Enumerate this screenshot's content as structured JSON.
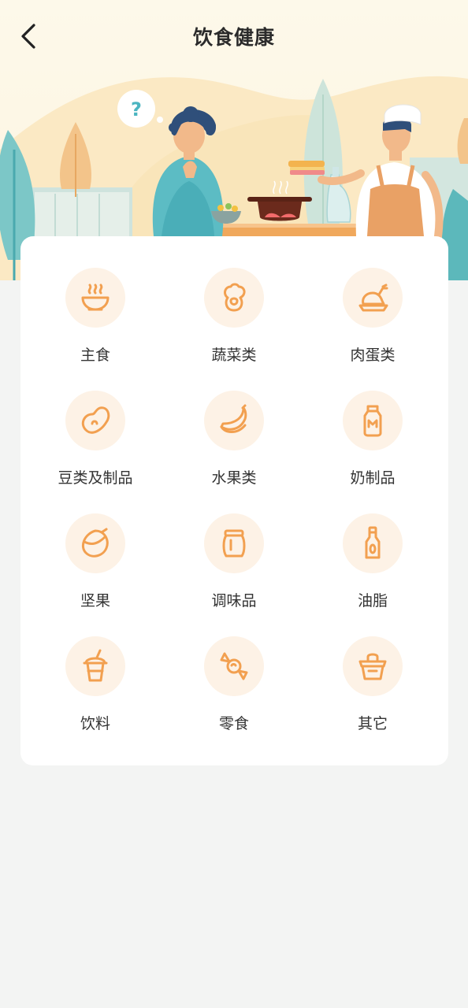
{
  "header": {
    "title": "饮食健康",
    "back_icon": "chevron-left-icon",
    "bubble_text": "?"
  },
  "colors": {
    "accent": "#f2a050",
    "icon_bg": "#fdf2e6",
    "page_bg": "#f3f4f3",
    "card_bg": "#ffffff"
  },
  "categories": [
    {
      "label": "主食",
      "icon": "rice-bowl-icon"
    },
    {
      "label": "蔬菜类",
      "icon": "vegetable-icon"
    },
    {
      "label": "肉蛋类",
      "icon": "roast-chicken-icon"
    },
    {
      "label": "豆类及制品",
      "icon": "bean-icon"
    },
    {
      "label": "水果类",
      "icon": "banana-icon"
    },
    {
      "label": "奶制品",
      "icon": "milk-bottle-icon"
    },
    {
      "label": "坚果",
      "icon": "nut-icon"
    },
    {
      "label": "调味品",
      "icon": "seasoning-jar-icon"
    },
    {
      "label": "油脂",
      "icon": "oil-bottle-icon"
    },
    {
      "label": "饮料",
      "icon": "drink-cup-icon"
    },
    {
      "label": "零食",
      "icon": "candy-icon"
    },
    {
      "label": "其它",
      "icon": "basket-icon"
    }
  ]
}
